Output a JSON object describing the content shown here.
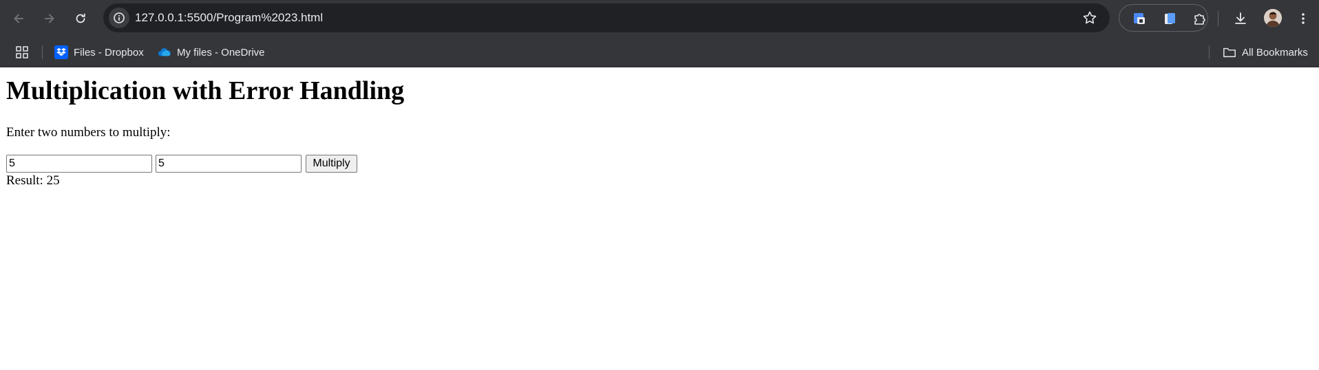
{
  "browser": {
    "url": "127.0.0.1:5500/Program%2023.html",
    "bookmarks": [
      {
        "label": "Files - Dropbox",
        "icon": "dropbox-icon"
      },
      {
        "label": "My files - OneDrive",
        "icon": "onedrive-icon"
      }
    ],
    "all_bookmarks_label": "All Bookmarks"
  },
  "page": {
    "heading": "Multiplication with Error Handling",
    "prompt": "Enter two numbers to multiply:",
    "input1_value": "5",
    "input2_value": "5",
    "button_label": "Multiply",
    "result_text": "Result: 25"
  },
  "colors": {
    "toolbar_bg": "#35363a",
    "omnibox_bg": "#202124",
    "dropbox_blue": "#0061fe",
    "onedrive_blue": "#0f78d4"
  }
}
